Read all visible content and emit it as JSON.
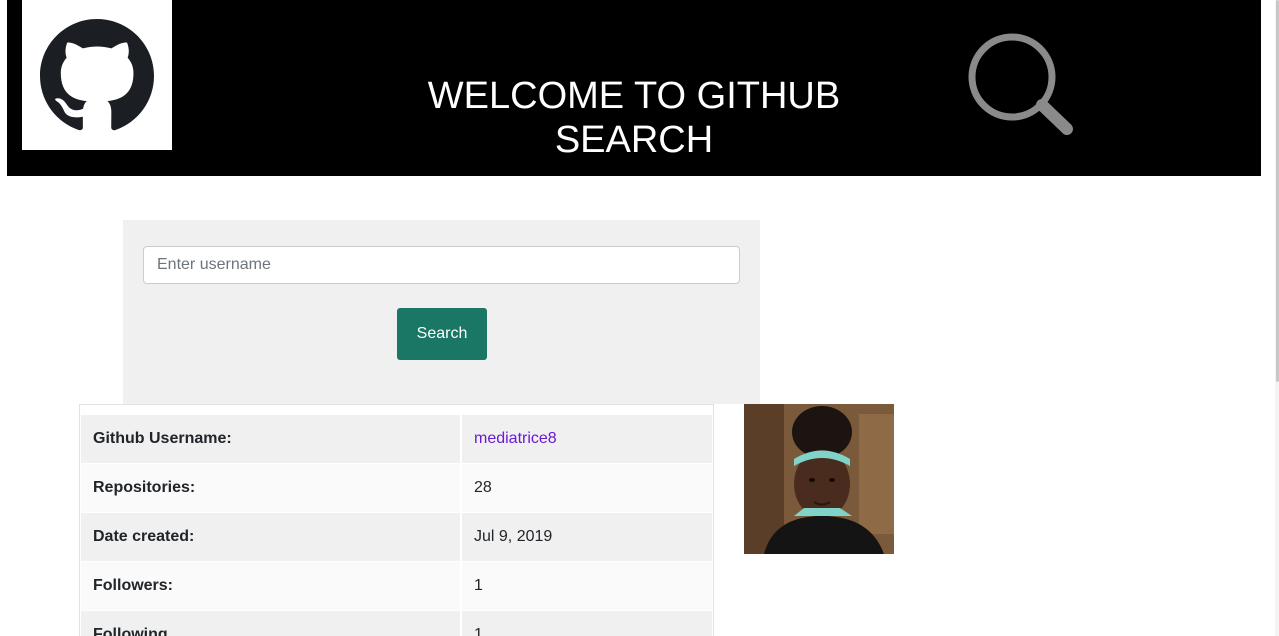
{
  "header": {
    "logo_icon": "github-octocat-icon",
    "title_line1": "WELCOME TO GITHUB",
    "title_line2": "SEARCH",
    "search_icon": "magnifier-icon"
  },
  "search": {
    "placeholder": "Enter username",
    "value": "",
    "button_label": "Search"
  },
  "details": {
    "rows": [
      {
        "label": "Github Username:",
        "value": "mediatrice8",
        "is_link": true
      },
      {
        "label": "Repositories:",
        "value": "28"
      },
      {
        "label": "Date created:",
        "value": "Jul 9, 2019"
      },
      {
        "label": "Followers:",
        "value": "1"
      },
      {
        "label": "Following",
        "value": "1"
      }
    ]
  },
  "profile": {
    "avatar_icon": "user-avatar-photo"
  },
  "colors": {
    "header_bg": "#000000",
    "button_bg": "#1a7766",
    "link": "#6a1bd1",
    "panel_bg": "#f0f0f0"
  }
}
